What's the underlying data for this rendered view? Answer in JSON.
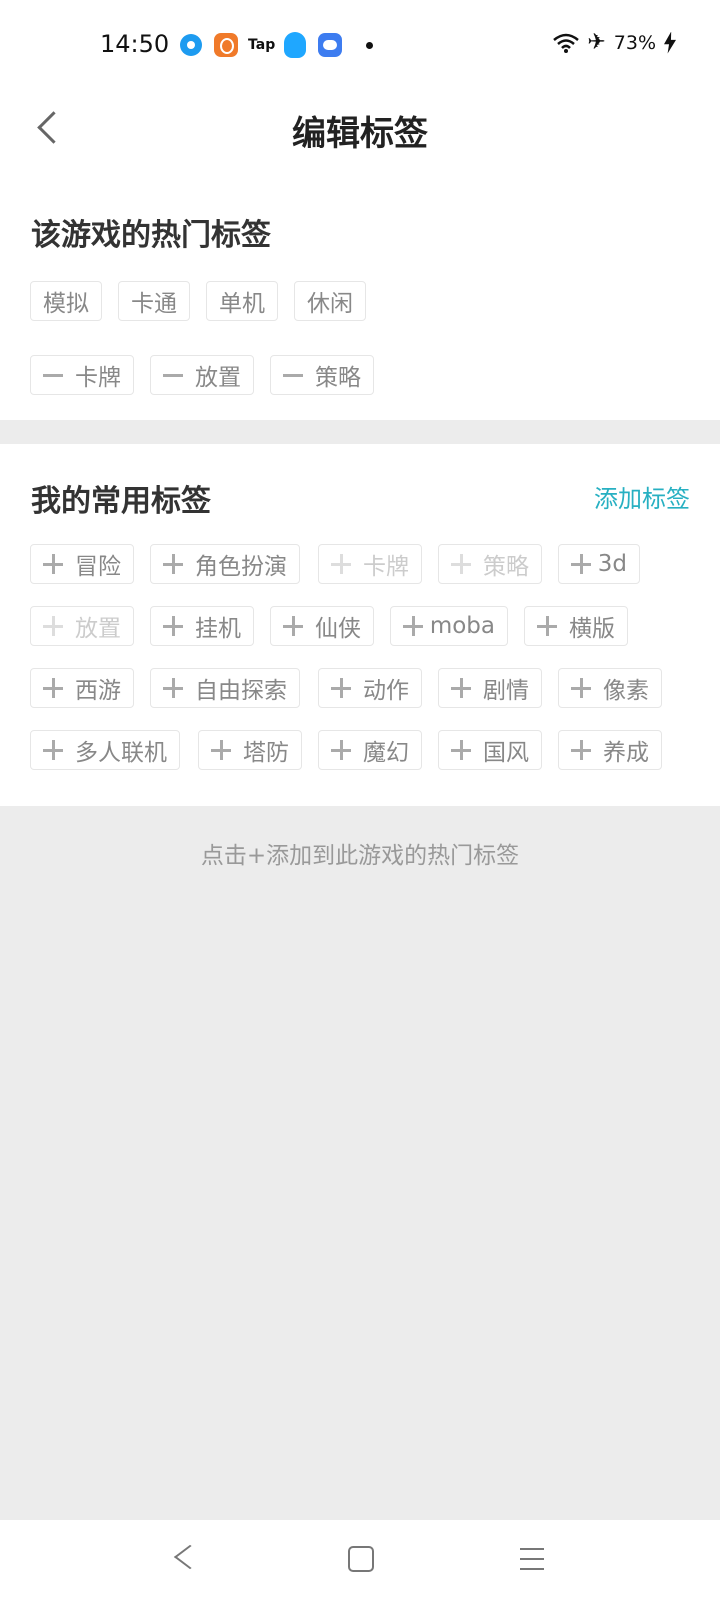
{
  "status": {
    "time": "14:50",
    "battery": "73%",
    "tap_label": "Tap"
  },
  "header": {
    "title": "编辑标签"
  },
  "hot_section": {
    "title": "该游戏的热门标签",
    "fixed_tags": [
      "模拟",
      "卡通",
      "单机",
      "休闲"
    ],
    "removable_tags": [
      "卡牌",
      "放置",
      "策略"
    ]
  },
  "my_section": {
    "title": "我的常用标签",
    "add_label": "添加标签",
    "tags": [
      {
        "label": "冒险",
        "disabled": false
      },
      {
        "label": "角色扮演",
        "disabled": false
      },
      {
        "label": "卡牌",
        "disabled": true
      },
      {
        "label": "策略",
        "disabled": true
      },
      {
        "label": "3d",
        "disabled": false
      },
      {
        "label": "放置",
        "disabled": true
      },
      {
        "label": "挂机",
        "disabled": false
      },
      {
        "label": "仙侠",
        "disabled": false
      },
      {
        "label": "moba",
        "disabled": false
      },
      {
        "label": "横版",
        "disabled": false
      },
      {
        "label": "西游",
        "disabled": false
      },
      {
        "label": "自由探索",
        "disabled": false
      },
      {
        "label": "动作",
        "disabled": false
      },
      {
        "label": "剧情",
        "disabled": false
      },
      {
        "label": "像素",
        "disabled": false
      },
      {
        "label": "多人联机",
        "disabled": false
      },
      {
        "label": "塔防",
        "disabled": false
      },
      {
        "label": "魔幻",
        "disabled": false
      },
      {
        "label": "国风",
        "disabled": false
      },
      {
        "label": "养成",
        "disabled": false
      }
    ]
  },
  "hint": "点击+添加到此游戏的热门标签",
  "accent_color": "#27b0c2"
}
